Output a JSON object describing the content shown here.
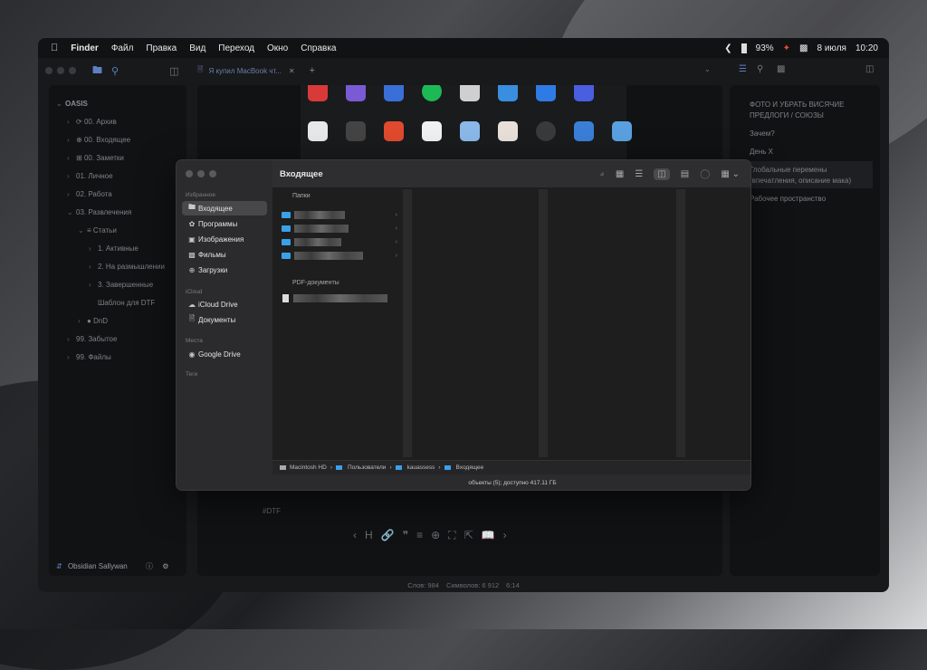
{
  "menubar": {
    "apple": "",
    "items": [
      "Finder",
      "Файл",
      "Правка",
      "Вид",
      "Переход",
      "Окно",
      "Справка"
    ],
    "battery": "93%",
    "date": "8 июля",
    "time": "10:20"
  },
  "obsidian": {
    "tab_title": "Я купил MacBook чт...",
    "vault": "OASIS",
    "tree": [
      {
        "label": "00. Архив",
        "depth": 1
      },
      {
        "label": "00. Входящее",
        "depth": 1
      },
      {
        "label": "00. Заметки",
        "depth": 1
      },
      {
        "label": "01. Личное",
        "depth": 1
      },
      {
        "label": "02. Работа",
        "depth": 1
      },
      {
        "label": "03. Развлечения",
        "depth": 1
      },
      {
        "label": "Статьи",
        "depth": 2
      },
      {
        "label": "1. Активные",
        "depth": 3
      },
      {
        "label": "2. На размышлении",
        "depth": 3
      },
      {
        "label": "3. Завершенные",
        "depth": 3
      },
      {
        "label": "Шаблон для DTF",
        "depth": 3
      },
      {
        "label": "DnD",
        "depth": 2
      },
      {
        "label": "99. Забытое",
        "depth": 1
      },
      {
        "label": "99. Файлы",
        "depth": 1
      }
    ],
    "user": "Obsidian Sallywan",
    "outline": [
      "ФОТО И УБРАТЬ ВИСЯЧИЕ",
      "ПРЕДЛОГИ / СОЮЗЫ",
      "Зачем?",
      "День Х",
      "Глобальные перемены",
      "(впечатления, описание мака)",
      "Рабочее пространство"
    ],
    "tag": "#DTF",
    "status": {
      "words": "Слов: 984",
      "chars": "Символов: 6 912",
      "time": "6:14"
    }
  },
  "finder": {
    "title": "Входящее",
    "sidebar": {
      "favorites_label": "Избранное",
      "favorites": [
        "Входящее",
        "Программы",
        "Изображения",
        "Фильмы",
        "Загрузки"
      ],
      "icloud_label": "iCloud",
      "icloud": [
        "iCloud Drive",
        "Документы"
      ],
      "places_label": "Места",
      "places": [
        "Google Drive"
      ],
      "tags_label": "Теги"
    },
    "groups": {
      "folders": "Папки",
      "pdf": "PDF-документы"
    },
    "path": [
      "Macintosh HD",
      "Пользователи",
      "kauassess",
      "Входящее"
    ],
    "status": "объекты (5); доступно 417.11 ГБ"
  }
}
